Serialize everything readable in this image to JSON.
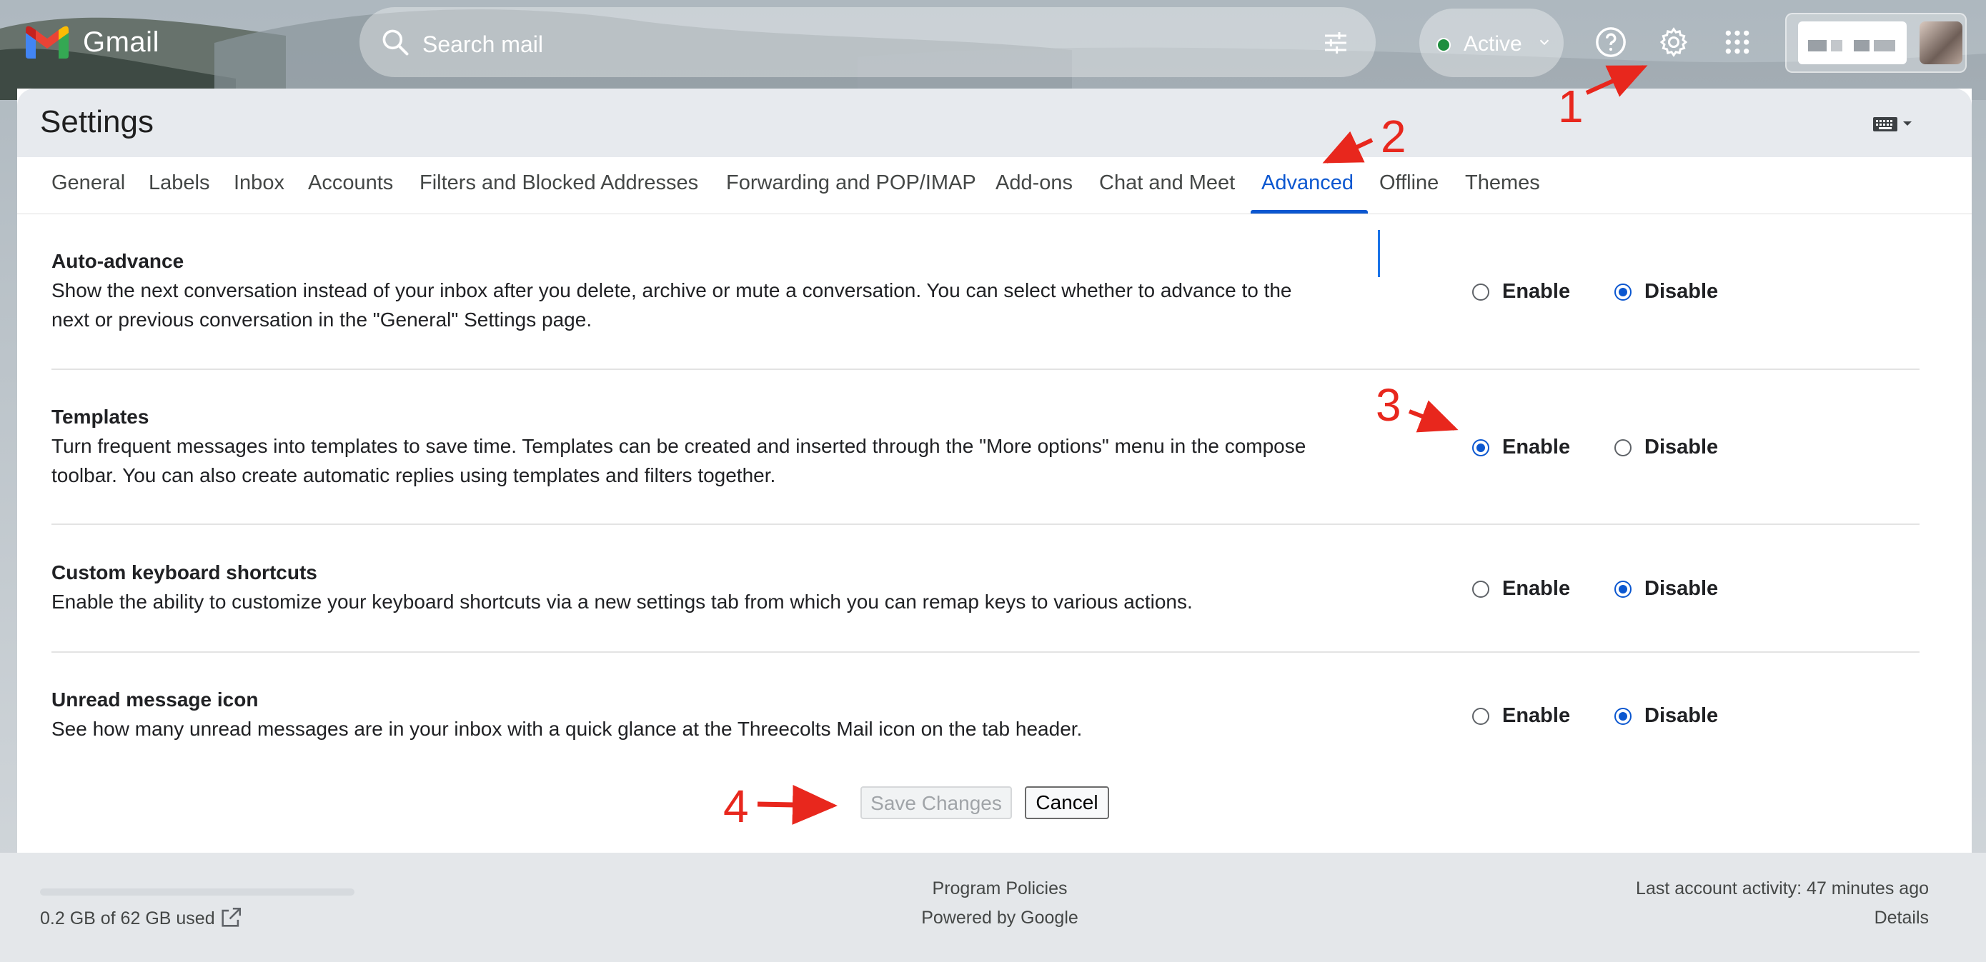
{
  "app": {
    "name": "Gmail"
  },
  "search": {
    "placeholder": "Search mail"
  },
  "status": {
    "label": "Active",
    "color": "#1e8e3e"
  },
  "icons": [
    "gmail-logo",
    "search-icon",
    "filter-sliders-icon",
    "chevron-down-icon",
    "help-icon",
    "gear-icon",
    "apps-grid-icon",
    "keyboard-icon",
    "external-link-icon"
  ],
  "settings": {
    "title": "Settings"
  },
  "tabs": [
    {
      "label": "General"
    },
    {
      "label": "Labels"
    },
    {
      "label": "Inbox"
    },
    {
      "label": "Accounts"
    },
    {
      "label": "Filters and Blocked Addresses"
    },
    {
      "label": "Forwarding and POP/IMAP"
    },
    {
      "label": "Add-ons"
    },
    {
      "label": "Chat and Meet"
    },
    {
      "label": "Advanced"
    },
    {
      "label": "Offline"
    },
    {
      "label": "Themes"
    }
  ],
  "active_tab": "Advanced",
  "sections": [
    {
      "title": "Auto-advance",
      "line1": "Show the next conversation instead of your inbox after you delete, archive or mute a conversation. You can select whether to advance to the",
      "line2": "next or previous conversation in the \"General\" Settings page.",
      "selected": "Disable"
    },
    {
      "title": "Templates",
      "line1": "Turn frequent messages into templates to save time. Templates can be created and inserted through the \"More options\" menu in the compose",
      "line2": "toolbar. You can also create automatic replies using templates and filters together.",
      "selected": "Enable"
    },
    {
      "title": "Custom keyboard shortcuts",
      "line1": "Enable the ability to customize your keyboard shortcuts via a new settings tab from which you can remap keys to various actions.",
      "selected": "Disable"
    },
    {
      "title": "Unread message icon",
      "line1": "See how many unread messages are in your inbox with a quick glance at the Threecolts Mail icon on the tab header.",
      "selected": "Disable"
    }
  ],
  "radio_labels": {
    "enable": "Enable",
    "disable": "Disable"
  },
  "buttons": {
    "save": "Save Changes",
    "cancel": "Cancel"
  },
  "footer": {
    "storage": "0.2 GB of 62 GB used",
    "program_policies": "Program Policies",
    "powered_by": "Powered by Google",
    "last_activity": "Last account activity: 47 minutes ago",
    "details": "Details"
  },
  "annotations": {
    "step1": "1",
    "step2": "2",
    "step3": "3",
    "step4": "4",
    "color": "#e8271d"
  },
  "colors": {
    "accent": "#0b57d0"
  }
}
